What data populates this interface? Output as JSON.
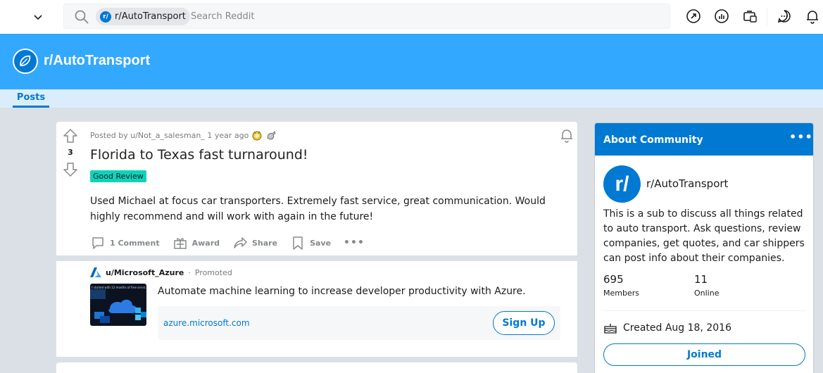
{
  "header": {
    "search_chip": "r/AutoTransport",
    "search_chip_avatar": "r/",
    "search_placeholder": "Search Reddit",
    "icons": [
      "chevron-down-icon",
      "search-icon",
      "popular-icon",
      "stats-icon",
      "mod-icon",
      "chat-icon",
      "notifications-icon"
    ]
  },
  "banner": {
    "title": "r/AutoTransport"
  },
  "tabs": [
    {
      "label": "Posts",
      "active": true
    }
  ],
  "post": {
    "vote_count": "3",
    "meta": "Posted by u/Not_a_salesman_ 1 year ago",
    "title": "Florida to Texas fast turnaround!",
    "flair": "Good Review",
    "flair_color": "#0dd3bb",
    "body": "Used Michael at focus car transporters. Extremely fast service, great communication. Would highly recommend and will work with again in the future!",
    "actions": {
      "comments": "1 Comment",
      "award": "Award",
      "share": "Share",
      "save": "Save",
      "more": "•••"
    }
  },
  "promoted": {
    "user": "u/Microsoft_Azure",
    "separator": "·",
    "tag": "Promoted",
    "thumb_text": "t started with 12 months of free servic",
    "text": "Automate machine learning to increase developer productivity with Azure.",
    "url": "azure.microsoft.com",
    "cta": "Sign Up"
  },
  "sidebar": {
    "title": "About Community",
    "more": "•••",
    "avatar": "r/",
    "name": "r/AutoTransport",
    "description": "This is a sub to discuss all things related to auto transport. Ask questions, review companies, get quotes, and car shippers can post info about their companies.",
    "members_count": "695",
    "members_label": "Members",
    "online_count": "11",
    "online_label": "Online",
    "created": "Created Aug 18, 2016",
    "joined_button": "Joined"
  },
  "colors": {
    "accent": "#0079d3",
    "banner": "#33a8ff",
    "tabs_bg": "#dbedfc",
    "page_bg": "#dae0e6"
  }
}
